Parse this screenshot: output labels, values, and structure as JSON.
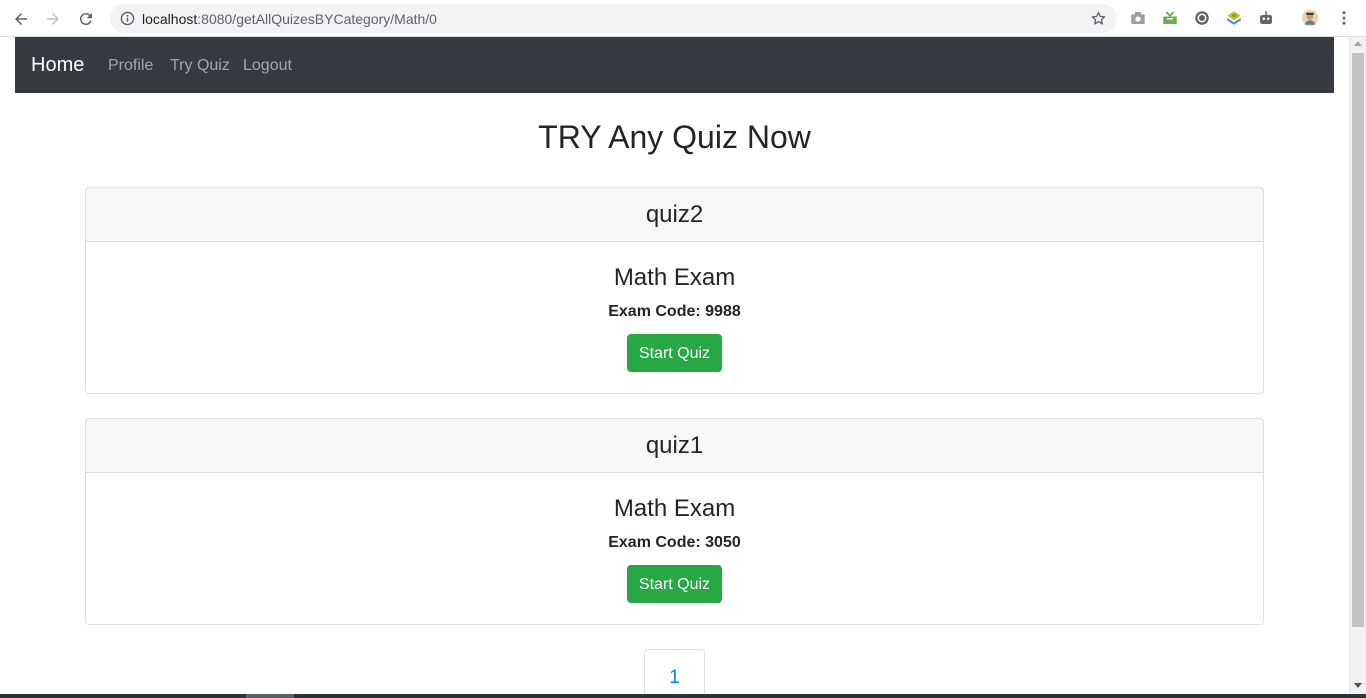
{
  "browser": {
    "url_host": "localhost",
    "url_rest": ":8080/getAllQuizesBYCategory/Math/0"
  },
  "navbar": {
    "brand": "Home",
    "links": [
      "Profile",
      "Try Quiz",
      "Logout"
    ]
  },
  "page": {
    "title": "TRY Any Quiz Now"
  },
  "quizzes": [
    {
      "name": "quiz2",
      "title": "Math Exam",
      "code_label": "Exam Code: 9988",
      "button": "Start Quiz"
    },
    {
      "name": "quiz1",
      "title": "Math Exam",
      "code_label": "Exam Code: 3050",
      "button": "Start Quiz"
    }
  ],
  "pagination": {
    "pages": [
      "1"
    ]
  },
  "colors": {
    "navbar_bg": "#343a40",
    "button_success": "#28a745",
    "link_primary": "#007bff"
  }
}
